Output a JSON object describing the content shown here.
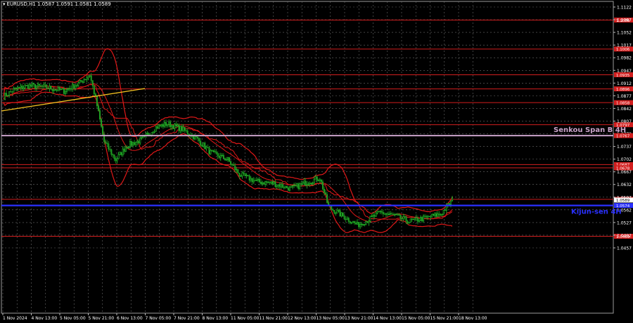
{
  "window": {
    "symbol_title": "EURUSD,H1  1.0587 1.0591 1.0581 1.0589"
  },
  "colors": {
    "background": "#000000",
    "grid": "#6b6b6b",
    "axis_text": "#ffffff",
    "level_line": "#d21e1e",
    "bullish_candle": "#22c52a",
    "bearish_candle": "#1e9e22",
    "ichimoku_lines": "#e01818",
    "trend_line": "#f2c020",
    "senkou_line": "#c9a3c9",
    "kijun_line": "#2a30ff",
    "kijun_label": "#2a30ff",
    "price_box": "#ffffff"
  },
  "axis": {
    "price_ticks": [
      "1.1122",
      "1.1087",
      "1.1052",
      "1.1017",
      "1.0982",
      "1.0947",
      "1.0912",
      "1.0877",
      "1.0842",
      "1.0807",
      "1.0772",
      "1.0737",
      "1.0702",
      "1.0667",
      "1.0632",
      "1.0597",
      "1.0562",
      "1.0527",
      "1.0492",
      "1.0457"
    ],
    "time_ticks": [
      "1 Nov 2024",
      "4 Nov 13:00",
      "5 Nov 05:00",
      "5 Nov 21:00",
      "6 Nov 13:00",
      "7 Nov 05:00",
      "7 Nov 21:00",
      "8 Nov 13:00",
      "11 Nov 05:00",
      "11 Nov 21:00",
      "12 Nov 13:00",
      "13 Nov 05:00",
      "13 Nov 21:00",
      "14 Nov 13:00",
      "15 Nov 05:00",
      "15 Nov 21:00",
      "18 Nov 13:00"
    ]
  },
  "levels": [
    {
      "price": 1.1086,
      "label": "1.1086"
    },
    {
      "price": 1.1006,
      "label": "1.1006"
    },
    {
      "price": 1.0935,
      "label": "1.0935"
    },
    {
      "price": 1.0896,
      "label": "1.0896"
    },
    {
      "price": 1.0858,
      "label": "1.0858"
    },
    {
      "price": 1.0797,
      "label": "1.0797"
    },
    {
      "price": 1.0687,
      "label": "1.0687"
    },
    {
      "price": 1.0678,
      "label": "1.0678"
    },
    {
      "price": 1.0591,
      "label": "1.0591"
    },
    {
      "price": 1.0489,
      "label": "1.0489"
    }
  ],
  "indicators": {
    "senkou_span_b": {
      "label": "Senkou Span B 4H",
      "price": 1.0767,
      "price_label": "1.0767"
    },
    "kijun_sen": {
      "label": "Kijun-sen 4H",
      "price": 1.0574,
      "price_label": "1.0574"
    },
    "current_price": {
      "price": 1.0589,
      "label": "1.0589"
    }
  },
  "chart_data": {
    "type": "candlestick",
    "symbol": "EURUSD",
    "timeframe": "H1",
    "ylim": [
      1.045,
      1.113
    ],
    "close_path": [
      {
        "t": 0,
        "price": 1.0875
      },
      {
        "t": 8,
        "price": 1.0895
      },
      {
        "t": 18,
        "price": 1.0905
      },
      {
        "t": 30,
        "price": 1.09
      },
      {
        "t": 42,
        "price": 1.089
      },
      {
        "t": 52,
        "price": 1.091
      },
      {
        "t": 60,
        "price": 1.0935
      },
      {
        "t": 64,
        "price": 1.087
      },
      {
        "t": 70,
        "price": 1.075
      },
      {
        "t": 78,
        "price": 1.07
      },
      {
        "t": 86,
        "price": 1.074
      },
      {
        "t": 96,
        "price": 1.0755
      },
      {
        "t": 106,
        "price": 1.079
      },
      {
        "t": 114,
        "price": 1.08
      },
      {
        "t": 124,
        "price": 1.0785
      },
      {
        "t": 134,
        "price": 1.076
      },
      {
        "t": 144,
        "price": 1.072
      },
      {
        "t": 156,
        "price": 1.07
      },
      {
        "t": 164,
        "price": 1.066
      },
      {
        "t": 176,
        "price": 1.064
      },
      {
        "t": 188,
        "price": 1.0635
      },
      {
        "t": 200,
        "price": 1.062
      },
      {
        "t": 212,
        "price": 1.064
      },
      {
        "t": 220,
        "price": 1.065
      },
      {
        "t": 226,
        "price": 1.057
      },
      {
        "t": 236,
        "price": 1.0545
      },
      {
        "t": 246,
        "price": 1.052
      },
      {
        "t": 254,
        "price": 1.0535
      },
      {
        "t": 262,
        "price": 1.0555
      },
      {
        "t": 272,
        "price": 1.0545
      },
      {
        "t": 282,
        "price": 1.053
      },
      {
        "t": 294,
        "price": 1.054
      },
      {
        "t": 304,
        "price": 1.055
      },
      {
        "t": 312,
        "price": 1.0589
      }
    ]
  }
}
